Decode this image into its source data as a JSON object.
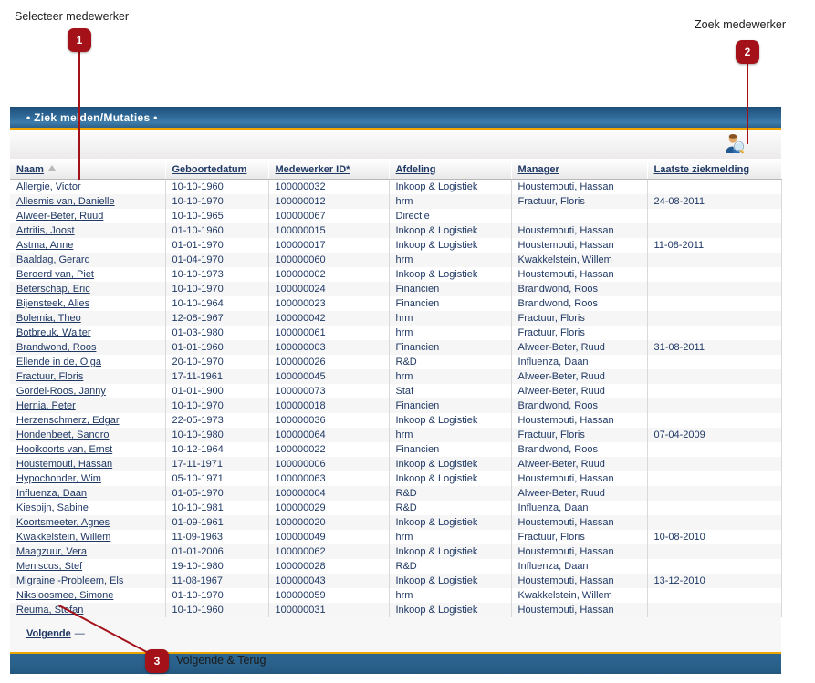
{
  "annotations": [
    {
      "number": "1",
      "label": "Selecteer medewerker"
    },
    {
      "number": "2",
      "label": "Zoek medewerker"
    },
    {
      "number": "3",
      "label": "Volgende & Terug"
    }
  ],
  "panel": {
    "title": "• Ziek melden/Mutaties •",
    "search_icon": "person-search-icon"
  },
  "table": {
    "columns": [
      {
        "key": "naam",
        "label": "Naam",
        "sorted": "asc"
      },
      {
        "key": "geboortedatum",
        "label": "Geboortedatum"
      },
      {
        "key": "medewerker_id",
        "label": "Medewerker ID*"
      },
      {
        "key": "afdeling",
        "label": "Afdeling"
      },
      {
        "key": "manager",
        "label": "Manager"
      },
      {
        "key": "laatste_ziekmelding",
        "label": "Laatste ziekmelding"
      }
    ],
    "rows": [
      {
        "naam": "Allergie, Victor",
        "geboortedatum": "10-10-1960",
        "medewerker_id": "100000032",
        "afdeling": "Inkoop & Logistiek",
        "manager": "Houstemouti, Hassan",
        "laatste_ziekmelding": ""
      },
      {
        "naam": "Allesmis van, Danielle",
        "geboortedatum": "10-10-1970",
        "medewerker_id": "100000012",
        "afdeling": "hrm",
        "manager": "Fractuur, Floris",
        "laatste_ziekmelding": "24-08-2011"
      },
      {
        "naam": "Alweer-Beter, Ruud",
        "geboortedatum": "10-10-1965",
        "medewerker_id": "100000067",
        "afdeling": "Directie",
        "manager": "",
        "laatste_ziekmelding": ""
      },
      {
        "naam": "Artritis, Joost",
        "geboortedatum": "01-10-1960",
        "medewerker_id": "100000015",
        "afdeling": "Inkoop & Logistiek",
        "manager": "Houstemouti, Hassan",
        "laatste_ziekmelding": ""
      },
      {
        "naam": "Astma, Anne",
        "geboortedatum": "01-01-1970",
        "medewerker_id": "100000017",
        "afdeling": "Inkoop & Logistiek",
        "manager": "Houstemouti, Hassan",
        "laatste_ziekmelding": "11-08-2011"
      },
      {
        "naam": "Baaldag, Gerard",
        "geboortedatum": "01-04-1970",
        "medewerker_id": "100000060",
        "afdeling": "hrm",
        "manager": "Kwakkelstein, Willem",
        "laatste_ziekmelding": ""
      },
      {
        "naam": "Beroerd van, Piet",
        "geboortedatum": "10-10-1973",
        "medewerker_id": "100000002",
        "afdeling": "Inkoop & Logistiek",
        "manager": "Houstemouti, Hassan",
        "laatste_ziekmelding": ""
      },
      {
        "naam": "Beterschap, Eric",
        "geboortedatum": "10-10-1970",
        "medewerker_id": "100000024",
        "afdeling": "Financien",
        "manager": "Brandwond, Roos",
        "laatste_ziekmelding": ""
      },
      {
        "naam": "Bijensteek, Alies",
        "geboortedatum": "10-10-1964",
        "medewerker_id": "100000023",
        "afdeling": "Financien",
        "manager": "Brandwond, Roos",
        "laatste_ziekmelding": ""
      },
      {
        "naam": "Bolemia, Theo",
        "geboortedatum": "12-08-1967",
        "medewerker_id": "100000042",
        "afdeling": "hrm",
        "manager": "Fractuur, Floris",
        "laatste_ziekmelding": ""
      },
      {
        "naam": "Botbreuk, Walter",
        "geboortedatum": "01-03-1980",
        "medewerker_id": "100000061",
        "afdeling": "hrm",
        "manager": "Fractuur, Floris",
        "laatste_ziekmelding": ""
      },
      {
        "naam": "Brandwond, Roos",
        "geboortedatum": "01-01-1960",
        "medewerker_id": "100000003",
        "afdeling": "Financien",
        "manager": "Alweer-Beter, Ruud",
        "laatste_ziekmelding": "31-08-2011"
      },
      {
        "naam": "Ellende in de, Olga",
        "geboortedatum": "20-10-1970",
        "medewerker_id": "100000026",
        "afdeling": "R&D",
        "manager": "Influenza, Daan",
        "laatste_ziekmelding": ""
      },
      {
        "naam": "Fractuur, Floris",
        "geboortedatum": "17-11-1961",
        "medewerker_id": "100000045",
        "afdeling": "hrm",
        "manager": "Alweer-Beter, Ruud",
        "laatste_ziekmelding": ""
      },
      {
        "naam": "Gordel-Roos, Janny",
        "geboortedatum": "01-01-1900",
        "medewerker_id": "100000073",
        "afdeling": "Staf",
        "manager": "Alweer-Beter, Ruud",
        "laatste_ziekmelding": ""
      },
      {
        "naam": "Hernia, Peter",
        "geboortedatum": "10-10-1970",
        "medewerker_id": "100000018",
        "afdeling": "Financien",
        "manager": "Brandwond, Roos",
        "laatste_ziekmelding": ""
      },
      {
        "naam": "Herzenschmerz, Edgar",
        "geboortedatum": "22-05-1973",
        "medewerker_id": "100000036",
        "afdeling": "Inkoop & Logistiek",
        "manager": "Houstemouti, Hassan",
        "laatste_ziekmelding": ""
      },
      {
        "naam": "Hondenbeet, Sandro",
        "geboortedatum": "10-10-1980",
        "medewerker_id": "100000064",
        "afdeling": "hrm",
        "manager": "Fractuur, Floris",
        "laatste_ziekmelding": "07-04-2009"
      },
      {
        "naam": "Hooikoorts van, Ernst",
        "geboortedatum": "10-12-1964",
        "medewerker_id": "100000022",
        "afdeling": "Financien",
        "manager": "Brandwond, Roos",
        "laatste_ziekmelding": ""
      },
      {
        "naam": "Houstemouti, Hassan",
        "geboortedatum": "17-11-1971",
        "medewerker_id": "100000006",
        "afdeling": "Inkoop & Logistiek",
        "manager": "Alweer-Beter, Ruud",
        "laatste_ziekmelding": ""
      },
      {
        "naam": "Hypochonder, Wim",
        "geboortedatum": "05-10-1971",
        "medewerker_id": "100000063",
        "afdeling": "Inkoop & Logistiek",
        "manager": "Houstemouti, Hassan",
        "laatste_ziekmelding": ""
      },
      {
        "naam": "Influenza, Daan",
        "geboortedatum": "01-05-1970",
        "medewerker_id": "100000004",
        "afdeling": "R&D",
        "manager": "Alweer-Beter, Ruud",
        "laatste_ziekmelding": ""
      },
      {
        "naam": "Kiespijn, Sabine",
        "geboortedatum": "10-10-1981",
        "medewerker_id": "100000029",
        "afdeling": "R&D",
        "manager": "Influenza, Daan",
        "laatste_ziekmelding": ""
      },
      {
        "naam": "Koortsmeeter, Agnes",
        "geboortedatum": "01-09-1961",
        "medewerker_id": "100000020",
        "afdeling": "Inkoop & Logistiek",
        "manager": "Houstemouti, Hassan",
        "laatste_ziekmelding": ""
      },
      {
        "naam": "Kwakkelstein, Willem",
        "geboortedatum": "11-09-1963",
        "medewerker_id": "100000049",
        "afdeling": "hrm",
        "manager": "Fractuur, Floris",
        "laatste_ziekmelding": "10-08-2010"
      },
      {
        "naam": "Maagzuur, Vera",
        "geboortedatum": "01-01-2006",
        "medewerker_id": "100000062",
        "afdeling": "Inkoop & Logistiek",
        "manager": "Houstemouti, Hassan",
        "laatste_ziekmelding": ""
      },
      {
        "naam": "Meniscus, Stef",
        "geboortedatum": "19-10-1980",
        "medewerker_id": "100000028",
        "afdeling": "R&D",
        "manager": "Influenza, Daan",
        "laatste_ziekmelding": ""
      },
      {
        "naam": "Migraine -Probleem, Els",
        "geboortedatum": "11-08-1967",
        "medewerker_id": "100000043",
        "afdeling": "Inkoop & Logistiek",
        "manager": "Houstemouti, Hassan",
        "laatste_ziekmelding": "13-12-2010"
      },
      {
        "naam": "Niksloosmee, Simone",
        "geboortedatum": "01-10-1970",
        "medewerker_id": "100000059",
        "afdeling": "hrm",
        "manager": "Kwakkelstein, Willem",
        "laatste_ziekmelding": ""
      },
      {
        "naam": "Reuma, Stefan",
        "geboortedatum": "10-10-1960",
        "medewerker_id": "100000031",
        "afdeling": "Inkoop & Logistiek",
        "manager": "Houstemouti, Hassan",
        "laatste_ziekmelding": ""
      }
    ]
  },
  "pager": {
    "next_label": "Volgende",
    "separator": "—"
  },
  "colors": {
    "accent_blue": "#2b6590",
    "gold": "#f0a500",
    "badge_red": "#a51118",
    "text_blue": "#1f3864"
  }
}
